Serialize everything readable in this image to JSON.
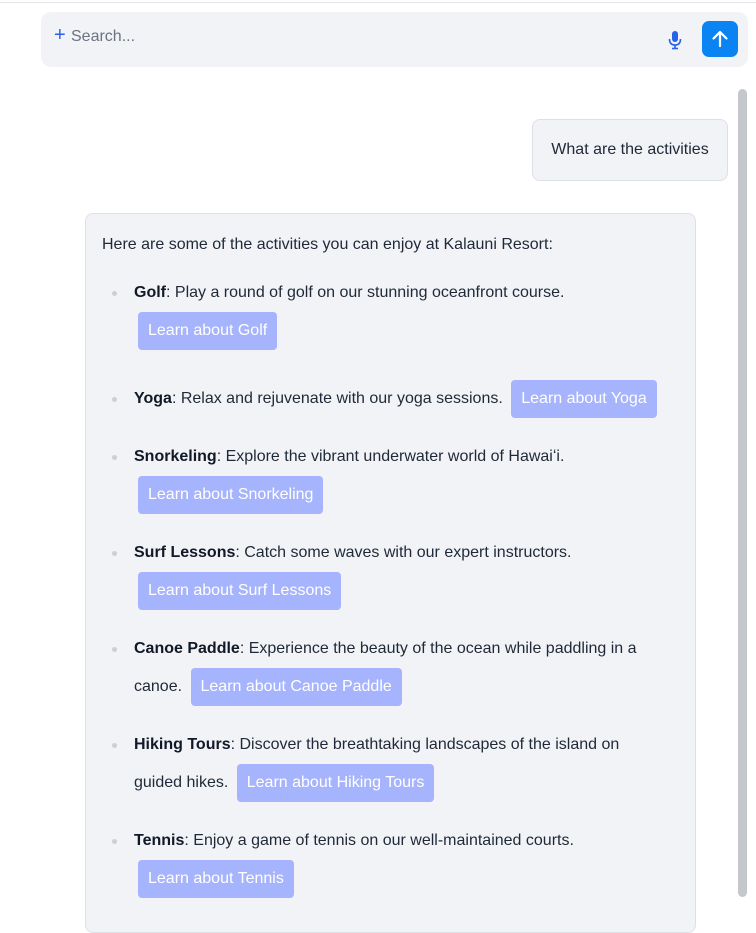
{
  "search": {
    "placeholder": "Search...",
    "value": "",
    "plus_symbol": "+",
    "mic_icon": "microphone-icon",
    "send_icon": "arrow-up-icon"
  },
  "colors": {
    "accent": "#0b84f3",
    "button_bg": "#a5b4fc",
    "bubble_bg": "#f1f3f6"
  },
  "chat": {
    "user_message": "What are the activities",
    "bot_intro": "Here are some of the activities you can enjoy at Kalauni Resort:",
    "activities": [
      {
        "title": "Golf",
        "description": ": Play a round of golf on our stunning oceanfront course.",
        "button": "Learn about Golf"
      },
      {
        "title": "Yoga",
        "description": ": Relax and rejuvenate with our yoga sessions.",
        "button": "Learn about Yoga"
      },
      {
        "title": "Snorkeling",
        "description": ": Explore the vibrant underwater world of Hawaiʻi.",
        "button": "Learn about Snorkeling"
      },
      {
        "title": "Surf Lessons",
        "description": ": Catch some waves with our expert instructors.",
        "button": "Learn about Surf Lessons"
      },
      {
        "title": "Canoe Paddle",
        "description": ": Experience the beauty of the ocean while paddling in a canoe.",
        "button": "Learn about Canoe Paddle"
      },
      {
        "title": "Hiking Tours",
        "description": ": Discover the breathtaking landscapes of the island on guided hikes.",
        "button": "Learn about Hiking Tours"
      },
      {
        "title": "Tennis",
        "description": ": Enjoy a game of tennis on our well-maintained courts.",
        "button": "Learn about Tennis"
      }
    ]
  }
}
